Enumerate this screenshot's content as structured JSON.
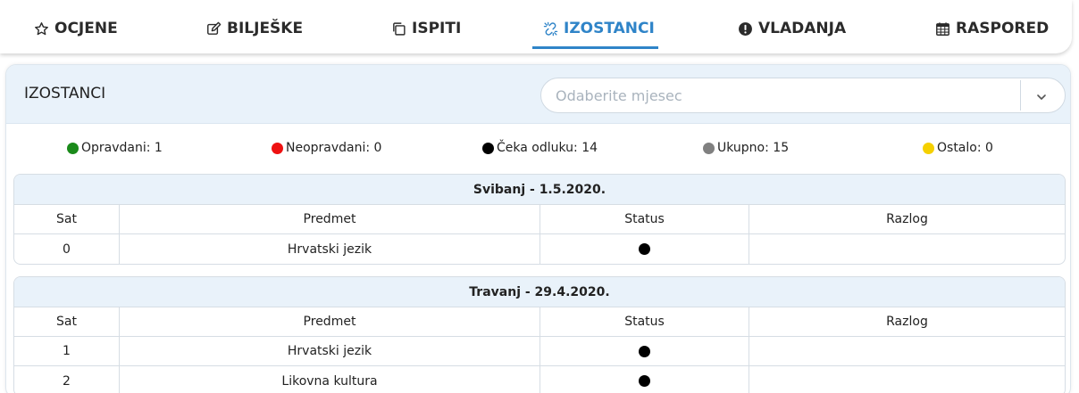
{
  "tabs": [
    {
      "label": "OCJENE",
      "icon": "star-outline-icon",
      "active": false
    },
    {
      "label": "BILJEŠKE",
      "icon": "edit-icon",
      "active": false
    },
    {
      "label": "ISPITI",
      "icon": "copy-icon",
      "active": false
    },
    {
      "label": "IZOSTANCI",
      "icon": "chain-break-icon",
      "active": true
    },
    {
      "label": "VLADANJA",
      "icon": "exclamation-circle-icon",
      "active": false
    },
    {
      "label": "RASPORED",
      "icon": "calendar-icon",
      "active": false
    }
  ],
  "card": {
    "title": "IZOSTANCI",
    "month_select": {
      "placeholder": "Odaberite mjesec"
    }
  },
  "legend": [
    {
      "label": "Opravdani: 1",
      "color": "#1a8a1a"
    },
    {
      "label": "Neopravdani: 0",
      "color": "#ee1111"
    },
    {
      "label": "Čeka odluku: 14",
      "color": "#000000"
    },
    {
      "label": "Ukupno: 15",
      "color": "#808080"
    },
    {
      "label": "Ostalo: 0",
      "color": "#f5d000"
    }
  ],
  "columns": [
    "Sat",
    "Predmet",
    "Status",
    "Razlog"
  ],
  "days": [
    {
      "title": "Svibanj - 1.5.2020.",
      "rows": [
        {
          "sat": "0",
          "predmet": "Hrvatski jezik",
          "status": "čeka odluku",
          "razlog": ""
        }
      ]
    },
    {
      "title": "Travanj - 29.4.2020.",
      "rows": [
        {
          "sat": "1",
          "predmet": "Hrvatski jezik",
          "status": "čeka odluku",
          "razlog": ""
        },
        {
          "sat": "2",
          "predmet": "Likovna kultura",
          "status": "čeka odluku",
          "razlog": ""
        }
      ]
    }
  ]
}
